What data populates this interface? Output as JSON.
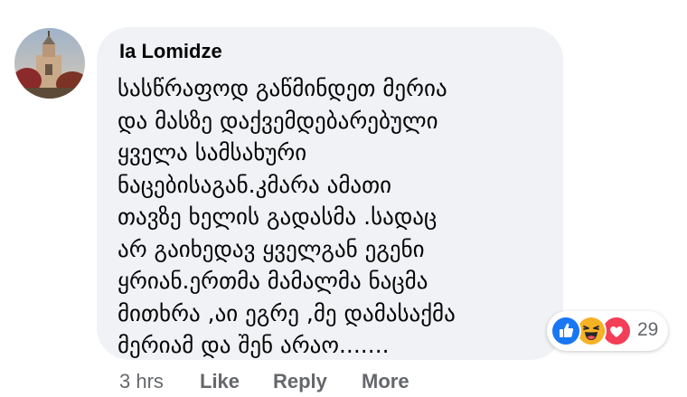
{
  "comment": {
    "author": "Ia Lomidze",
    "text": "სასწრაფოდ გაწმინდეთ მერია\nდა მასზე დაქვემდებარებული\nყველა სამსახური\nნაცებისაგან.კმარა ამათი\nთავზე ხელის გადასმა .სადაც\nარ გაიხედავ ყველგან ეგენი\nყრიან.ერთმა მამალმა ნაცმა\nმითხრა ,აი ეგრე ,მე დამასაქმა\nმერიამ და შენ არაო......."
  },
  "reactions": {
    "icons": [
      "like-reaction-icon",
      "haha-reaction-icon",
      "love-reaction-icon"
    ],
    "count": "29"
  },
  "actions": {
    "time": "3 hrs",
    "like": "Like",
    "reply": "Reply",
    "more": "More"
  },
  "colors": {
    "bubble": "#f0f2f5",
    "text": "#050505",
    "secondary": "#65676b",
    "like_blue": "#1877f2",
    "haha_yellow": "#f7b125",
    "love_red": "#f33e58"
  }
}
